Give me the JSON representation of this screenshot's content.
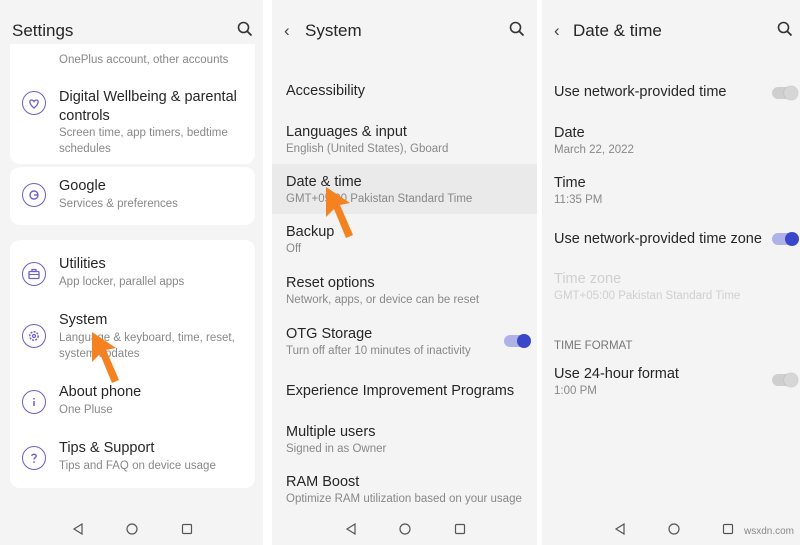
{
  "colors": {
    "accent": "#6c5fc7",
    "arrow": "#f58220",
    "toggle_on": "#3b47c9"
  },
  "panel1": {
    "title": "Settings",
    "cards": [
      {
        "items": [
          {
            "sub": "OnePlus account, other accounts"
          },
          {
            "icon": "wellbeing-icon",
            "title_line1": "Digital Wellbeing & parental",
            "title_line2": "controls",
            "sub_line1": "Screen time, app timers, bedtime",
            "sub_line2": "schedules"
          }
        ]
      },
      {
        "items": [
          {
            "icon": "google-icon",
            "title": "Google",
            "sub": "Services & preferences"
          }
        ]
      },
      {
        "items": [
          {
            "icon": "utilities-icon",
            "title": "Utilities",
            "sub": "App locker, parallel apps"
          },
          {
            "icon": "system-gear-icon",
            "title": "System",
            "sub_line1": "Language & keyboard, time, reset,",
            "sub_line2": "system updates"
          },
          {
            "icon": "info-icon",
            "title": "About phone",
            "sub": "One Pluse"
          },
          {
            "icon": "help-icon",
            "title": "Tips & Support",
            "sub": "Tips and FAQ on device usage"
          }
        ]
      }
    ]
  },
  "panel2": {
    "title": "System",
    "items": [
      {
        "title": "Accessibility"
      },
      {
        "title": "Languages & input",
        "sub": "English (United States), Gboard"
      },
      {
        "title": "Date & time",
        "sub": "GMT+05:00 Pakistan Standard Time"
      },
      {
        "title": "Backup",
        "sub": "Off"
      },
      {
        "title": "Reset options",
        "sub": "Network, apps, or device can be reset"
      },
      {
        "title": "OTG Storage",
        "sub": "Turn off after 10 minutes of inactivity",
        "toggle": "on"
      },
      {
        "title": "Experience Improvement Programs"
      },
      {
        "title": "Multiple users",
        "sub": "Signed in as Owner"
      },
      {
        "title": "RAM Boost",
        "sub": "Optimize RAM utilization based on your usage"
      }
    ]
  },
  "panel3": {
    "title": "Date & time",
    "items": [
      {
        "title": "Use network-provided time",
        "toggle": "off"
      },
      {
        "title": "Date",
        "sub": "March 22, 2022"
      },
      {
        "title": "Time",
        "sub": "11:35 PM"
      },
      {
        "title": "Use network-provided time zone",
        "toggle": "on"
      },
      {
        "title": "Time zone",
        "sub": "GMT+05:00 Pakistan Standard Time",
        "disabled": true
      },
      {
        "section": "TIME FORMAT"
      },
      {
        "title": "Use 24-hour format",
        "sub": "1:00 PM",
        "toggle": "off"
      }
    ]
  },
  "watermark": "wsxdn.com"
}
